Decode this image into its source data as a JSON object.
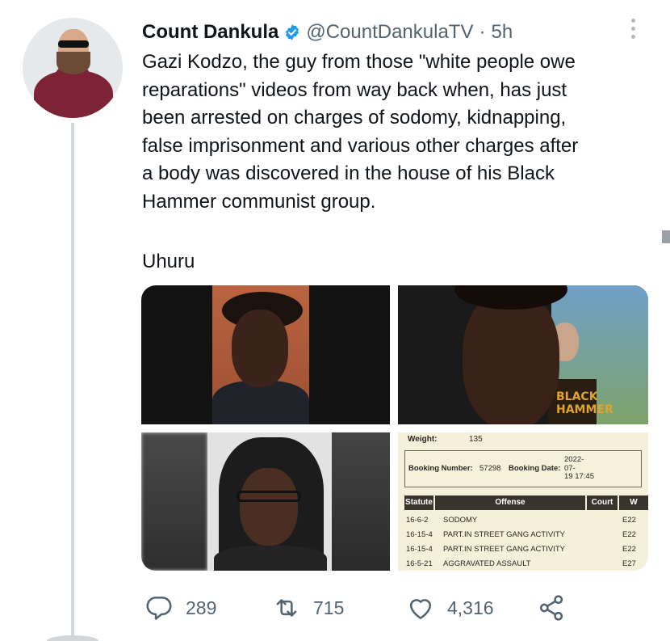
{
  "tweet": {
    "author_name": "Count Dankula",
    "handle": "@CountDankulaTV",
    "separator": "·",
    "time": "5h",
    "text": "Gazi Kodzo, the guy from those \"white people owe\nreparations\" videos from way back when, has just\nbeen arrested on charges of sodomy, kidnapping,\nfalse imprisonment and various other charges after\na body was discovered in the house of his Black\nHammer communist group.",
    "text_2": "Uhuru"
  },
  "media": {
    "image_4_print": "BLACK HAMMER",
    "booking": {
      "weight_label": "Weight:",
      "weight_value": "135",
      "booking_number_label": "Booking Number:",
      "booking_number": "57298",
      "booking_date_label": "Booking Date:",
      "booking_date": "2022-\n07-\n19 17:45",
      "columns": [
        "Statute",
        "Offense",
        "Court",
        "W"
      ],
      "rows": [
        {
          "statute": "16-6-2",
          "offense": "SODOMY",
          "court": "E22"
        },
        {
          "statute": "16-15-4",
          "offense": "PART.IN STREET GANG ACTIVITY",
          "court": "E22"
        },
        {
          "statute": "16-15-4",
          "offense": "PART.IN STREET GANG ACTIVITY",
          "court": "E22"
        },
        {
          "statute": "16-5-21",
          "offense": "AGGRAVATED ASSAULT",
          "court": "E27"
        }
      ]
    }
  },
  "actions": {
    "replies": "289",
    "retweets": "715",
    "likes": "4,316"
  },
  "icons": {
    "verified": "verified-badge-icon",
    "more": "more-vertical-icon",
    "reply": "reply-icon",
    "retweet": "retweet-icon",
    "like": "heart-icon",
    "share": "share-icon"
  },
  "colors": {
    "verified_blue": "#1d9bf0",
    "secondary_text": "#536471",
    "thread_line": "#cfd9de"
  }
}
